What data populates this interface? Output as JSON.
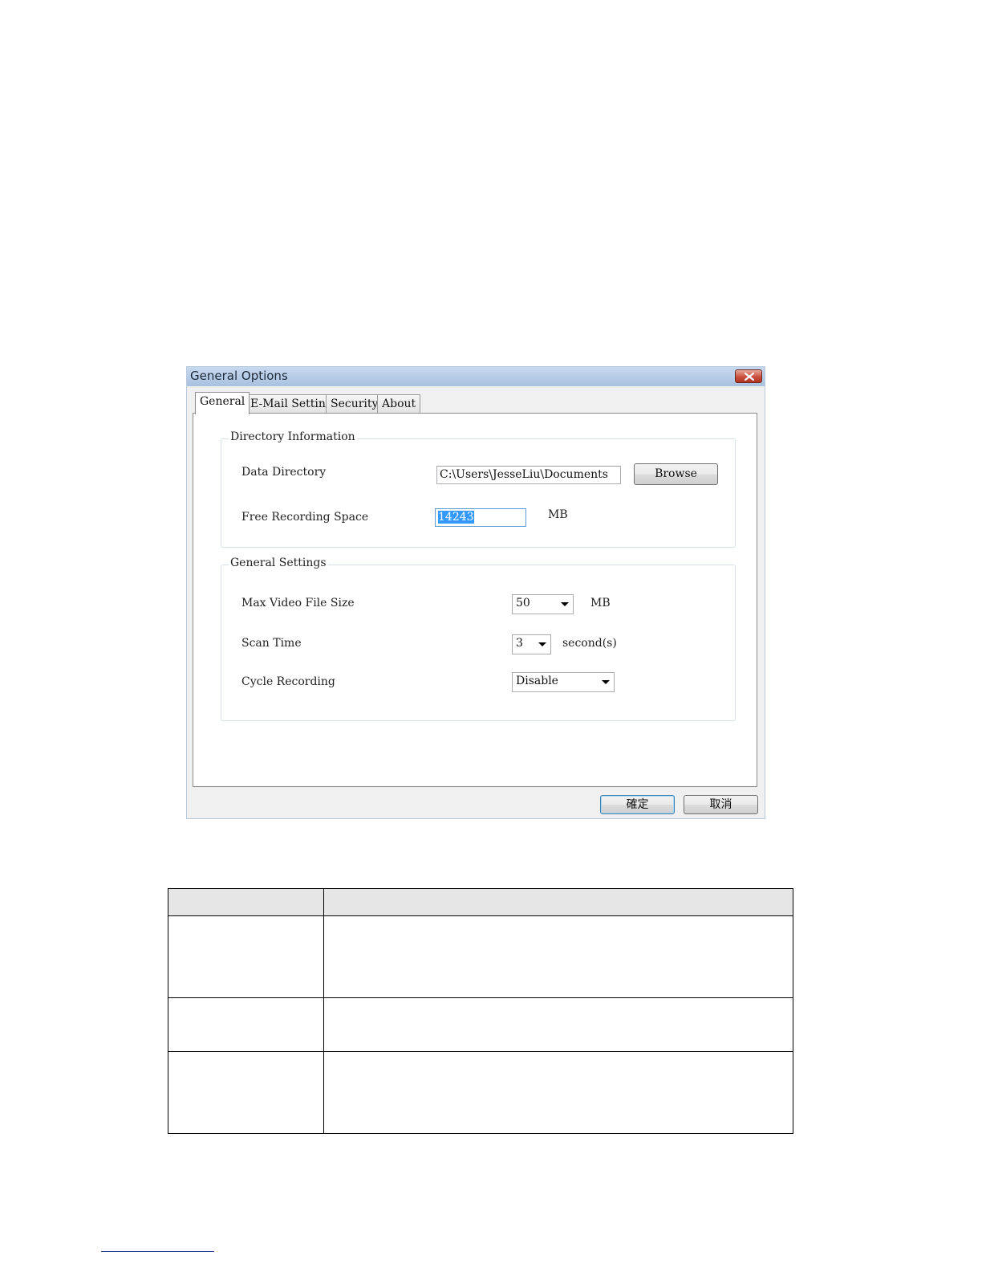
{
  "dialog": {
    "title": "General Options",
    "tabs": [
      {
        "label": "General",
        "active": true
      },
      {
        "label": "E-Mail Setting",
        "active": false
      },
      {
        "label": "Security",
        "active": false
      },
      {
        "label": "About",
        "active": false
      }
    ],
    "directory_info": {
      "title": "Directory Information",
      "data_directory_label": "Data Directory",
      "data_directory_value": "C:\\Users\\JesseLiu\\Documents",
      "browse_label": "Browse",
      "free_space_label": "Free Recording Space",
      "free_space_value": "14243",
      "free_space_unit": "MB"
    },
    "general_settings": {
      "title": "General Settings",
      "max_file_size_label": "Max Video File Size",
      "max_file_size_value": "50",
      "max_file_size_unit": "MB",
      "scan_time_label": "Scan Time",
      "scan_time_value": "3",
      "scan_time_unit": "second(s)",
      "cycle_recording_label": "Cycle Recording",
      "cycle_recording_value": "Disable"
    },
    "ok_label": "確定",
    "cancel_label": "取消"
  },
  "icons": {
    "close": "close-icon",
    "dropdown": "chevron-down-icon"
  },
  "colors": {
    "titlebar": "#a9c1df",
    "close_button": "#c9503e",
    "selection": "#3399ff",
    "table_header": "#e6e6e6",
    "footer_rule": "#2a3c8e"
  }
}
